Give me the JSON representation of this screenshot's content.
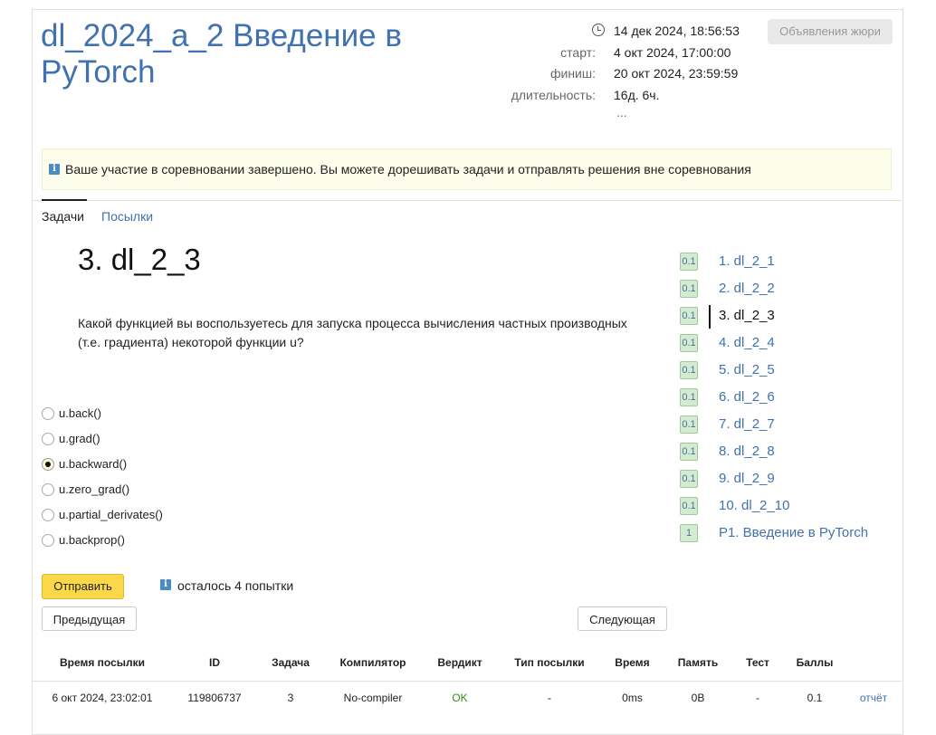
{
  "contest": {
    "title": "dl_2024_a_2 Введение в PyTorch",
    "current_time": "14 дек 2024, 18:56:53",
    "start_label": "старт:",
    "start_value": "4 окт 2024, 17:00:00",
    "finish_label": "финиш:",
    "finish_value": "20 окт 2024, 23:59:59",
    "duration_label": "длительность:",
    "duration_value": "16д. 6ч.",
    "more_link": "...",
    "jury_button": "Объявления жюри"
  },
  "alert": {
    "icon": "info-icon",
    "text": "Ваше участие в соревновании завершено. Вы можете дорешивать задачи и отправлять решения вне соревнования"
  },
  "tabs": [
    {
      "label": "Задачи",
      "active": true
    },
    {
      "label": "Посылки",
      "active": false
    }
  ],
  "problem": {
    "title": "3. dl_2_3",
    "question": "Какой функцией вы воспользуетесь для запуска процесса вычисления частных производных (т.е. градиента) некоторой функции u?",
    "options": [
      {
        "label": "u.back()",
        "checked": false
      },
      {
        "label": "u.grad()",
        "checked": false
      },
      {
        "label": "u.backward()",
        "checked": true
      },
      {
        "label": "u.zero_grad()",
        "checked": false
      },
      {
        "label": "u.partial_derivates()",
        "checked": false
      },
      {
        "label": "u.backprop()",
        "checked": false
      }
    ],
    "submit_button": "Отправить",
    "attempts_text": "осталось 4 попытки",
    "prev_button": "Предыдущая",
    "next_button": "Следующая"
  },
  "problem_list": [
    {
      "score": "0.1",
      "label": "1. dl_2_1",
      "current": false
    },
    {
      "score": "0.1",
      "label": "2. dl_2_2",
      "current": false
    },
    {
      "score": "0.1",
      "label": "3. dl_2_3",
      "current": true
    },
    {
      "score": "0.1",
      "label": "4. dl_2_4",
      "current": false
    },
    {
      "score": "0.1",
      "label": "5. dl_2_5",
      "current": false
    },
    {
      "score": "0.1",
      "label": "6. dl_2_6",
      "current": false
    },
    {
      "score": "0.1",
      "label": "7. dl_2_7",
      "current": false
    },
    {
      "score": "0.1",
      "label": "8. dl_2_8",
      "current": false
    },
    {
      "score": "0.1",
      "label": "9. dl_2_9",
      "current": false
    },
    {
      "score": "0.1",
      "label": "10. dl_2_10",
      "current": false
    },
    {
      "score": "1",
      "label": "P1. Введение в PyTorch",
      "current": false
    }
  ],
  "submissions": {
    "headers": [
      "Время посылки",
      "ID",
      "Задача",
      "Компилятор",
      "Вердикт",
      "Тип посылки",
      "Время",
      "Память",
      "Тест",
      "Баллы"
    ],
    "rows": [
      {
        "time": "6 окт 2024, 23:02:01",
        "id": "119806737",
        "task": "3",
        "compiler": "No-compiler",
        "verdict": "OK",
        "type": "-",
        "run_time": "0ms",
        "memory": "0B",
        "test": "-",
        "score": "0.1",
        "report_link": "отчёт"
      }
    ]
  },
  "colors": {
    "link": "#3f72af",
    "accent_button": "#fbd84a",
    "ok": "#3a8a1c",
    "alert_bg": "#fdfdeb",
    "score_badge": "#d3ebd0"
  }
}
